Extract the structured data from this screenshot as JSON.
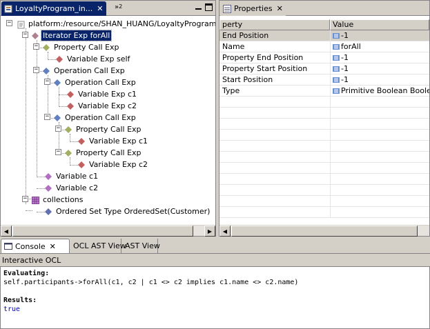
{
  "colors": {
    "selection": "#0a246a",
    "panel": "#d4d0c8",
    "diamond_purple": "#b070c0",
    "diamond_red": "#c06060",
    "diamond_green": "#a0b060",
    "diamond_blue": "#6080c0",
    "result_blue": "#0000c0"
  },
  "editor": {
    "tab_label": "LoyaltyProgram_in...",
    "overflow_count": "2",
    "tree": [
      {
        "label": "platform:/resource/SHAN_HUANG/LoyaltyProgram_inva",
        "icon": "resource-file-icon"
      },
      {
        "label": "Iterator Exp forAll",
        "icon": "iterator-exp-icon",
        "selected": true
      },
      {
        "label": "Property Call Exp",
        "icon": "property-call-icon"
      },
      {
        "label": "Variable Exp self",
        "icon": "variable-exp-icon"
      },
      {
        "label": "Operation Call Exp",
        "icon": "operation-call-icon"
      },
      {
        "label": "Operation Call Exp",
        "icon": "operation-call-icon"
      },
      {
        "label": "Variable Exp c1",
        "icon": "variable-exp-icon"
      },
      {
        "label": "Variable Exp c2",
        "icon": "variable-exp-icon"
      },
      {
        "label": "Operation Call Exp",
        "icon": "operation-call-icon"
      },
      {
        "label": "Property Call Exp",
        "icon": "property-call-icon"
      },
      {
        "label": "Variable Exp c1",
        "icon": "variable-exp-icon"
      },
      {
        "label": "Property Call Exp",
        "icon": "property-call-icon"
      },
      {
        "label": "Variable Exp c2",
        "icon": "variable-exp-icon"
      },
      {
        "label": "Variable c1",
        "icon": "variable-icon"
      },
      {
        "label": "Variable c2",
        "icon": "variable-icon"
      },
      {
        "label": "collections",
        "icon": "package-icon"
      },
      {
        "label": "Ordered Set Type OrderedSet(Customer)",
        "icon": "type-icon"
      }
    ]
  },
  "properties": {
    "tab_label": "Properties",
    "col_property": "perty",
    "col_value": "Value",
    "rows": [
      {
        "property": "End Position",
        "value": "-1",
        "selected": true
      },
      {
        "property": "Name",
        "value": "forAll"
      },
      {
        "property": "Property End Position",
        "value": "-1"
      },
      {
        "property": "Property Start Position",
        "value": "-1"
      },
      {
        "property": "Start Position",
        "value": "-1"
      },
      {
        "property": "Type",
        "value": "Primitive Boolean Boolean"
      }
    ]
  },
  "console": {
    "tabs": [
      {
        "label": "Console",
        "active": true
      },
      {
        "label": "OCL AST View"
      },
      {
        "label": "AST View"
      }
    ],
    "title": "Interactive OCL",
    "lines": [
      {
        "text": "Evaluating:",
        "style": "bold"
      },
      {
        "text": "self.participants->forAll(c1, c2 | c1 <> c2 implies c1.name <> c2.name)",
        "style": "normal"
      },
      {
        "text": "",
        "style": "normal"
      },
      {
        "text": "Results:",
        "style": "bold"
      },
      {
        "text": "true",
        "style": "blue"
      }
    ]
  }
}
